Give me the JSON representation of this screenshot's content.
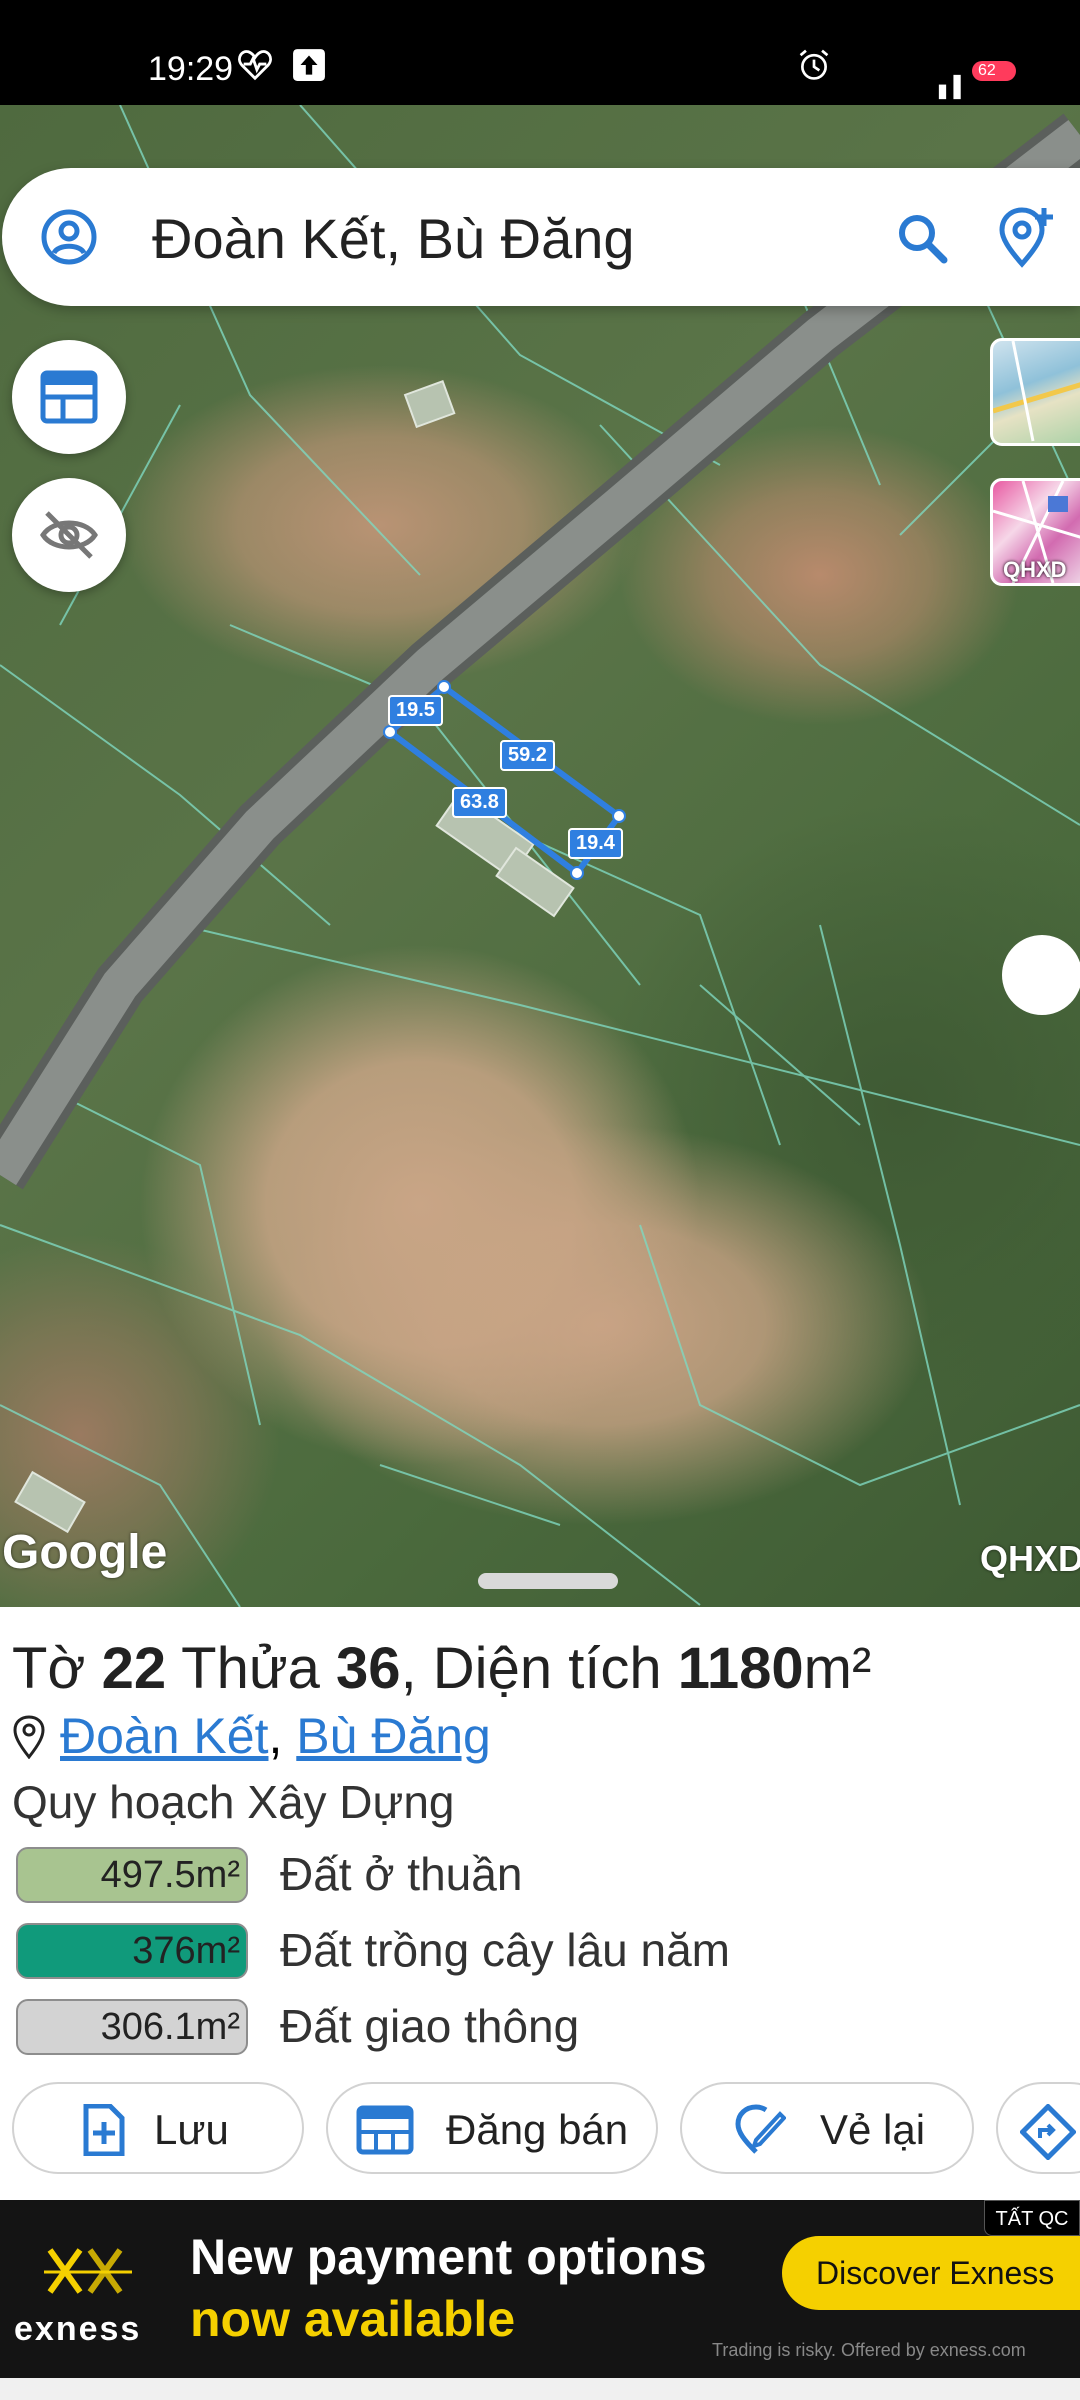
{
  "status_bar": {
    "time": "19:29",
    "battery": "62",
    "icons": [
      "heart-rate-icon",
      "upload-icon",
      "alarm-icon",
      "signal-icon",
      "battery-icon"
    ]
  },
  "search": {
    "title": "Đoàn Kết, Bù Đăng",
    "icons": [
      "account-icon",
      "search-icon",
      "location-add-icon"
    ]
  },
  "map": {
    "edge_labels": [
      "19.5",
      "59.2",
      "63.8",
      "19.4"
    ],
    "google_label": "Google",
    "layer_label": "QHXD",
    "thumb_qhxd_label": "QHXD",
    "buttons": [
      "planning-table-icon",
      "hide-icon"
    ]
  },
  "parcel": {
    "sheet_prefix": "Tờ ",
    "sheet_no": "22",
    "plot_prefix": " Thửa ",
    "plot_no": "36",
    "area_prefix": ", Diện tích ",
    "area": "1180",
    "area_unit": "m²",
    "commune": "Đoàn Kết",
    "separator": ", ",
    "district": "Bù Đăng",
    "plan_label": "Quy hoạch Xây Dựng",
    "zones": [
      {
        "area": "497.5m²",
        "name": "Đất ở thuần",
        "color": "#a8c490"
      },
      {
        "area": "376m²",
        "name": "Đất trồng cây lâu năm",
        "color": "#109a7b"
      },
      {
        "area": "306.1m²",
        "name": "Đất giao thông",
        "color": "#d3d3d3"
      }
    ]
  },
  "actions": {
    "save": "Lưu",
    "sell": "Đăng bán",
    "redraw": "Vẻ lại"
  },
  "ad": {
    "brand": "exness",
    "line1": "New payment options",
    "line2": "now available",
    "cta": "Discover Exness",
    "disclaimer": "Trading is risky. Offered by exness.com",
    "close_all": "TẤT QC"
  },
  "colors": {
    "accent": "#2a7ad2",
    "parcel_outline": "#2f7fe0",
    "ad_yellow": "#f5d000"
  }
}
